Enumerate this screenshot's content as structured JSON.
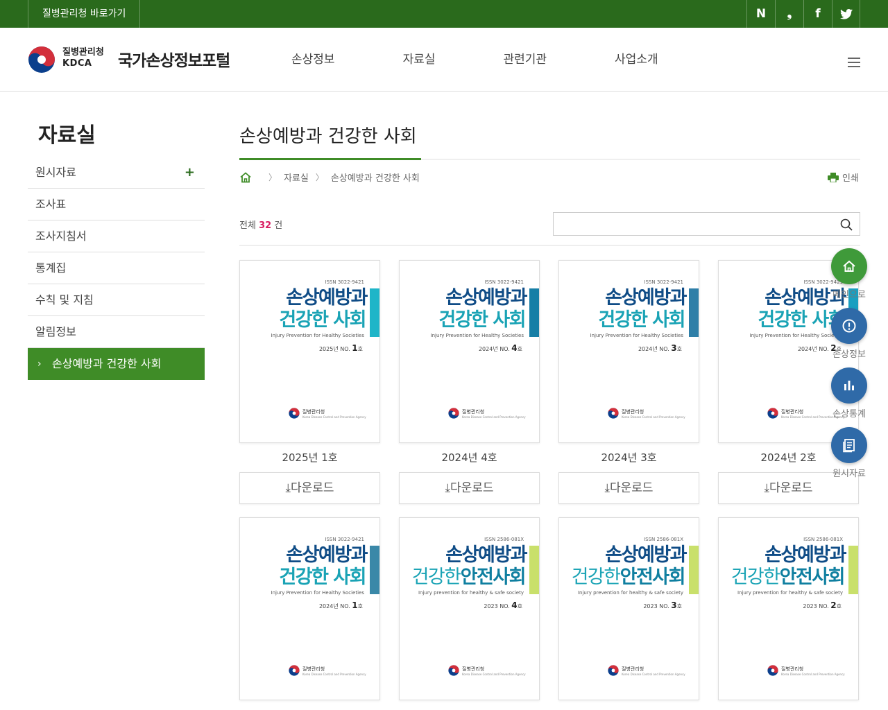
{
  "topbar": {
    "go_link": "질병관리청 바로가기",
    "sns": [
      "N",
      "❟",
      "f",
      "t"
    ]
  },
  "header": {
    "org_name": "질병관리청",
    "org_en": "KDCA",
    "portal_title": "국가손상정보포털",
    "nav": [
      "손상정보",
      "자료실",
      "관련기관",
      "사업소개"
    ]
  },
  "sidebar": {
    "title": "자료실",
    "items": [
      {
        "label": "원시자료",
        "has_plus": true
      },
      {
        "label": "조사표"
      },
      {
        "label": "조사지침서"
      },
      {
        "label": "통계집"
      },
      {
        "label": "수칙 및 지침"
      },
      {
        "label": "알림정보"
      },
      {
        "label": "손상예방과 건강한 사회",
        "active": true
      }
    ],
    "plus": "+",
    "arrow": "›"
  },
  "content": {
    "title": "손상예방과 건강한 사회",
    "breadcrumb": [
      "자료실",
      "손상예방과 건강한 사회"
    ],
    "print": "인쇄",
    "total_prefix": "전체",
    "total_count": "32",
    "total_suffix": "건",
    "search_placeholder": ""
  },
  "cards": [
    {
      "label": "2025년 1호",
      "download": "⤓다운로드",
      "issn": "ISSN 3022-9421",
      "t1": "손상예방과",
      "t2": "건강한 사회",
      "sub": "Injury Prevention for Healthy Societies",
      "issue_year": "2025년 NO.",
      "issue_no": "1",
      "issue_suffix": "호",
      "style": "new",
      "bar": "#1fb5c8"
    },
    {
      "label": "2024년 4호",
      "download": "⤓다운로드",
      "issn": "ISSN 3022-9421",
      "t1": "손상예방과",
      "t2": "건강한 사회",
      "sub": "Injury Prevention for Healthy Societies",
      "issue_year": "2024년 NO.",
      "issue_no": "4",
      "issue_suffix": "호",
      "style": "new",
      "bar": "#177fa6"
    },
    {
      "label": "2024년 3호",
      "download": "⤓다운로드",
      "issn": "ISSN 3022-9421",
      "t1": "손상예방과",
      "t2": "건강한 사회",
      "sub": "Injury Prevention for Healthy Societies",
      "issue_year": "2024년 NO.",
      "issue_no": "3",
      "issue_suffix": "호",
      "style": "new",
      "bar": "#2f7fa8"
    },
    {
      "label": "2024년 2호",
      "download": "⤓다운로드",
      "issn": "ISSN 3022-9421",
      "t1": "손상예방과",
      "t2": "건강한 사회",
      "sub": "Injury Prevention for Healthy Societies",
      "issue_year": "2024년 NO.",
      "issue_no": "2",
      "issue_suffix": "호",
      "style": "new",
      "bar": "#1a9fc0"
    },
    {
      "label": "",
      "download": "",
      "issn": "ISSN 3022-9421",
      "t1": "손상예방과",
      "t2": "건강한 사회",
      "sub": "Injury Prevention for Healthy Societies",
      "issue_year": "2024년 NO.",
      "issue_no": "1",
      "issue_suffix": "호",
      "style": "new",
      "bar": "#3a88a8"
    },
    {
      "label": "",
      "download": "",
      "issn": "ISSN 2586-081X",
      "t1": "손상예방과",
      "t2a": "건강한",
      "t2b": "안전사회",
      "sub": "Injury prevention for healthy & safe society",
      "issue_year": "2023 NO.",
      "issue_no": "4",
      "issue_suffix": "호",
      "style": "old",
      "bar": "#c9e06b"
    },
    {
      "label": "",
      "download": "",
      "issn": "ISSN 2586-081X",
      "t1": "손상예방과",
      "t2a": "건강한",
      "t2b": "안전사회",
      "sub": "Injury prevention for healthy & safe society",
      "issue_year": "2023 NO.",
      "issue_no": "3",
      "issue_suffix": "호",
      "style": "old",
      "bar": "#c9e06b"
    },
    {
      "label": "",
      "download": "",
      "issn": "ISSN 2586-081X",
      "t1": "손상예방과",
      "t2a": "건강한",
      "t2b": "안전사회",
      "sub": "Injury prevention for healthy & safe society",
      "issue_year": "2023 NO.",
      "issue_no": "2",
      "issue_suffix": "호",
      "style": "old",
      "bar": "#c9e06b"
    }
  ],
  "cover_agency": "질병관리청",
  "cover_agency_sub": "Korea Disease Control and Prevention Agency",
  "quick_menu": [
    {
      "label": "메인으로",
      "color": "#3f9a3a",
      "icon": "home-icon"
    },
    {
      "label": "손상정보",
      "color": "#2f6aa8",
      "icon": "alert-icon"
    },
    {
      "label": "손상통계",
      "color": "#2f6aa8",
      "icon": "chart-icon"
    },
    {
      "label": "원시자료",
      "color": "#2f6aa8",
      "icon": "document-icon"
    }
  ],
  "colors": {
    "topbar": "#2a6a1c",
    "accent": "#3f8c27",
    "count": "#d81b60"
  }
}
